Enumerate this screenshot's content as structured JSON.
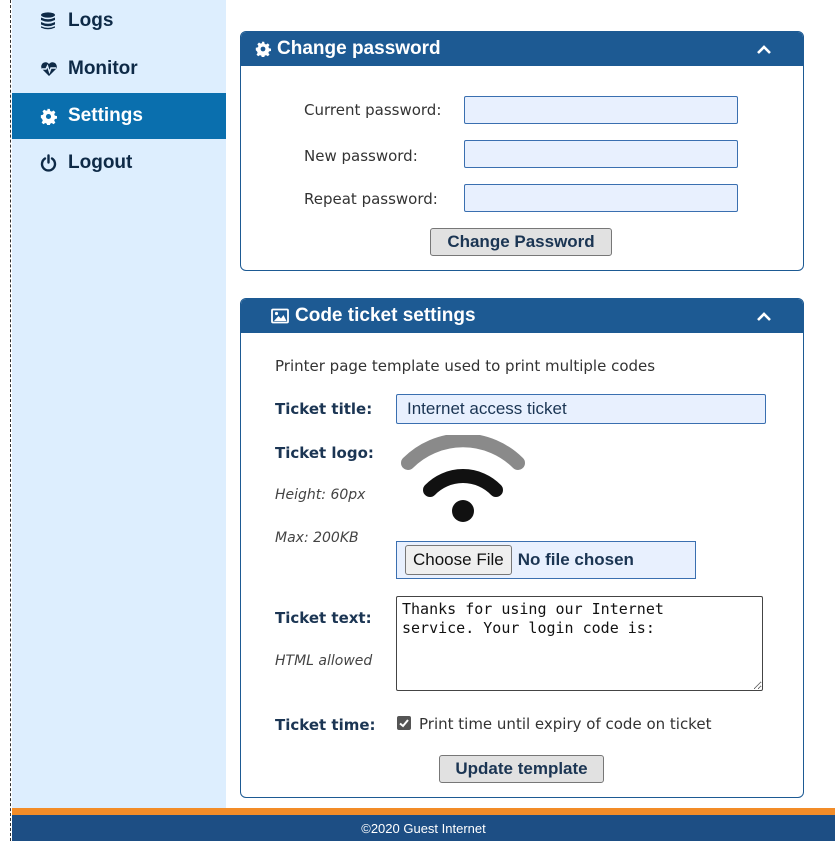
{
  "sidebar": {
    "items": [
      {
        "label": "Logs",
        "icon": "database-icon",
        "active": false
      },
      {
        "label": "Monitor",
        "icon": "heartbeat-icon",
        "active": false
      },
      {
        "label": "Settings",
        "icon": "gear-icon",
        "active": true
      },
      {
        "label": "Logout",
        "icon": "power-icon",
        "active": false
      }
    ]
  },
  "password_panel": {
    "title": "Change password",
    "current_label": "Current password:",
    "new_label": "New password:",
    "repeat_label": "Repeat password:",
    "current_value": "",
    "new_value": "",
    "repeat_value": "",
    "button_label": "Change Password"
  },
  "ticket_panel": {
    "title": "Code ticket settings",
    "description": "Printer page template used to print multiple codes",
    "title_label": "Ticket title:",
    "title_value": "Internet access ticket",
    "logo_label": "Ticket logo:",
    "logo_height_hint": "Height: 60px",
    "logo_max_hint": "Max: 200KB",
    "choose_file_label": "Choose File",
    "no_file_label": "No file chosen",
    "text_label": "Ticket text:",
    "text_hint": "HTML allowed",
    "text_value": "Thanks for using our Internet\nservice. Your login code is:",
    "time_label": "Ticket time:",
    "time_checked": true,
    "time_checkbox_label": "Print time until expiry of code on ticket",
    "button_label": "Update template"
  },
  "footer": {
    "text": "©2020 Guest Internet"
  },
  "colors": {
    "accent": "#1d5a93",
    "sidebar_bg": "#ddeefe",
    "active_item": "#0a6fae",
    "orange": "#f28c28",
    "footer_bg": "#1d4e84"
  }
}
